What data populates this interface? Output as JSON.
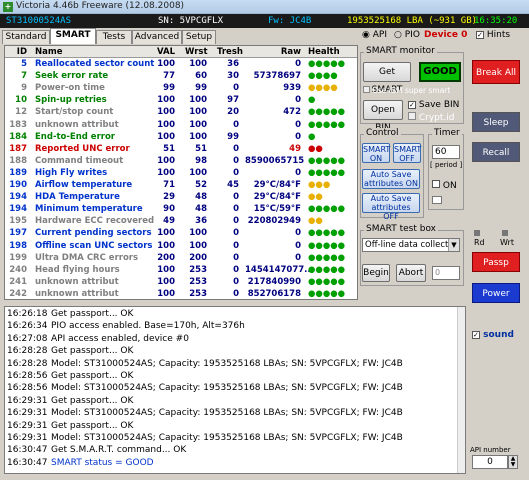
{
  "window": {
    "title": "Victoria 4.46b Freeware (12.08.2008)",
    "app_icon": "+"
  },
  "infobar": {
    "model": "ST31000524AS",
    "serial": "SN: 5VPCGFLX",
    "firmware": "Fw: JC4B",
    "capacity": "1953525168 LBA (~931 GB)",
    "time": "16:35:20"
  },
  "tabs": [
    "Standard",
    "SMART",
    "Tests",
    "Advanced",
    "Setup"
  ],
  "mode": {
    "api": "API",
    "pio": "PIO",
    "device": "Device 0",
    "hints": "Hints"
  },
  "table": {
    "headers": [
      "ID",
      "Name",
      "VAL",
      "Wrst",
      "Tresh",
      "Raw",
      "Health"
    ],
    "rows": [
      {
        "id": "5",
        "name": "Reallocated sector count",
        "val": "100",
        "wrst": "100",
        "tresh": "36",
        "raw": "0",
        "health": "●●●●●",
        "color": "#0033cc",
        "hcolor": "#00a000"
      },
      {
        "id": "7",
        "name": "Seek error rate",
        "val": "77",
        "wrst": "60",
        "tresh": "30",
        "raw": "57378697",
        "health": "●●●●",
        "color": "#008000",
        "hcolor": "#00a000"
      },
      {
        "id": "9",
        "name": "Power-on time",
        "val": "99",
        "wrst": "99",
        "tresh": "0",
        "raw": "939",
        "health": "●●●●",
        "color": "#808080",
        "hcolor": "#e8b000"
      },
      {
        "id": "10",
        "name": "Spin-up retries",
        "val": "100",
        "wrst": "100",
        "tresh": "97",
        "raw": "0",
        "health": "●",
        "color": "#008000",
        "hcolor": "#00a000"
      },
      {
        "id": "12",
        "name": "Start/stop count",
        "val": "100",
        "wrst": "100",
        "tresh": "20",
        "raw": "472",
        "health": "●●●●●",
        "color": "#808080",
        "hcolor": "#00a000"
      },
      {
        "id": "183",
        "name": "unknown attribut",
        "val": "100",
        "wrst": "100",
        "tresh": "0",
        "raw": "0",
        "health": "●●●●●",
        "color": "#808080",
        "hcolor": "#00a000"
      },
      {
        "id": "184",
        "name": "End-to-End error",
        "val": "100",
        "wrst": "100",
        "tresh": "99",
        "raw": "0",
        "health": "●",
        "color": "#008000",
        "hcolor": "#00a000"
      },
      {
        "id": "187",
        "name": "Reported UNC error",
        "val": "51",
        "wrst": "51",
        "tresh": "0",
        "raw": "49",
        "health": "●●",
        "color": "#cc0000",
        "hcolor": "#cc0000"
      },
      {
        "id": "188",
        "name": "Command timeout",
        "val": "100",
        "wrst": "98",
        "tresh": "0",
        "raw": "8590065715",
        "health": "●●●●●",
        "color": "#808080",
        "hcolor": "#00a000"
      },
      {
        "id": "189",
        "name": "High Fly writes",
        "val": "100",
        "wrst": "100",
        "tresh": "0",
        "raw": "0",
        "health": "●●●●●",
        "color": "#0033cc",
        "hcolor": "#00a000"
      },
      {
        "id": "190",
        "name": "Airflow temperature",
        "val": "71",
        "wrst": "52",
        "tresh": "45",
        "raw": "29°C/84°F",
        "health": "●●●",
        "color": "#0033cc",
        "hcolor": "#e8b000"
      },
      {
        "id": "194",
        "name": "HDA Temperature",
        "val": "29",
        "wrst": "48",
        "tresh": "0",
        "raw": "29°C/84°F",
        "health": "●●",
        "color": "#0033cc",
        "hcolor": "#e8b000"
      },
      {
        "id": "194",
        "name": "Minimum temperature",
        "val": "90",
        "wrst": "48",
        "tresh": "0",
        "raw": "15°C/59°F",
        "health": "●●●●●",
        "color": "#0033cc",
        "hcolor": "#00a000"
      },
      {
        "id": "195",
        "name": "Hardware ECC recovered",
        "val": "49",
        "wrst": "36",
        "tresh": "0",
        "raw": "220802949",
        "health": "●●",
        "color": "#808080",
        "hcolor": "#e8b000"
      },
      {
        "id": "197",
        "name": "Current pending sectors",
        "val": "100",
        "wrst": "100",
        "tresh": "0",
        "raw": "0",
        "health": "●●●●●",
        "color": "#0033cc",
        "hcolor": "#00a000"
      },
      {
        "id": "198",
        "name": "Offline scan UNC sectors",
        "val": "100",
        "wrst": "100",
        "tresh": "0",
        "raw": "0",
        "health": "●●●●●",
        "color": "#0033cc",
        "hcolor": "#00a000"
      },
      {
        "id": "199",
        "name": "Ultra DMA CRC errors",
        "val": "200",
        "wrst": "200",
        "tresh": "0",
        "raw": "0",
        "health": "●●●●●",
        "color": "#808080",
        "hcolor": "#00a000"
      },
      {
        "id": "240",
        "name": "Head flying hours",
        "val": "100",
        "wrst": "253",
        "tresh": "0",
        "raw": "1454147077...",
        "health": "●●●●●",
        "color": "#808080",
        "hcolor": "#00a000"
      },
      {
        "id": "241",
        "name": "unknown attribut",
        "val": "100",
        "wrst": "253",
        "tresh": "0",
        "raw": "217840990",
        "health": "●●●●●",
        "color": "#808080",
        "hcolor": "#00a000"
      },
      {
        "id": "242",
        "name": "unknown attribut",
        "val": "100",
        "wrst": "253",
        "tresh": "0",
        "raw": "852706178",
        "health": "●●●●●",
        "color": "#808080",
        "hcolor": "#00a000"
      }
    ]
  },
  "smart_monitor": {
    "label": "SMART monitor",
    "get_smart": "Get SMART",
    "status": "GOOD",
    "use_ibm": "Use IBM super smart",
    "open_bin": "Open BIN",
    "save_bin": "Save BIN",
    "crypt": "Crypt.id"
  },
  "control": {
    "label": "Control",
    "smart_on": "SMART ON",
    "smart_off": "SMART OFF",
    "auto_save_on": "Auto Save attributes ON",
    "auto_save_off": "Auto Save attributes OFF"
  },
  "timer": {
    "label": "Timer",
    "value": "60",
    "period": "[ period ]",
    "on": "ON"
  },
  "test_box": {
    "label": "SMART test box",
    "selected": "Off-line data collect",
    "begin": "Begin",
    "abort": "Abort",
    "value": "0"
  },
  "side": {
    "break_all": "Break All",
    "sleep": "Sleep",
    "recall": "Recall",
    "rd": "Rd",
    "wrt": "Wrt",
    "passp": "Passp",
    "power": "Power",
    "sound": "sound",
    "api_number_label": "API number",
    "api_number": "0"
  },
  "log": [
    {
      "t": "16:26:18",
      "m": "Get passport... OK",
      "c": "#000"
    },
    {
      "t": "16:26:34",
      "m": "PIO access enabled. Base=170h, Alt=376h",
      "c": "#000"
    },
    {
      "t": "16:27:08",
      "m": "API access enabled, device #0",
      "c": "#000"
    },
    {
      "t": "16:28:28",
      "m": "Get passport... OK",
      "c": "#000"
    },
    {
      "t": "16:28:28",
      "m": "Model: ST31000524AS; Capacity: 1953525168 LBAs; SN: 5VPCGFLX; FW: JC4B",
      "c": "#000"
    },
    {
      "t": "16:28:56",
      "m": "Get passport... OK",
      "c": "#000"
    },
    {
      "t": "16:28:56",
      "m": "Model: ST31000524AS; Capacity: 1953525168 LBAs; SN: 5VPCGFLX; FW: JC4B",
      "c": "#000"
    },
    {
      "t": "16:29:31",
      "m": "Get passport... OK",
      "c": "#000"
    },
    {
      "t": "16:29:31",
      "m": "Model: ST31000524AS; Capacity: 1953525168 LBAs; SN: 5VPCGFLX; FW: JC4B",
      "c": "#000"
    },
    {
      "t": "16:29:31",
      "m": "Get passport... OK",
      "c": "#000"
    },
    {
      "t": "16:29:31",
      "m": "Model: ST31000524AS; Capacity: 1953525168 LBAs; SN: 5VPCGFLX; FW: JC4B",
      "c": "#000"
    },
    {
      "t": "16:30:47",
      "m": "Get S.M.A.R.T. command... OK",
      "c": "#000"
    },
    {
      "t": "16:30:47",
      "m": "SMART status = GOOD",
      "c": "#0033cc"
    }
  ]
}
